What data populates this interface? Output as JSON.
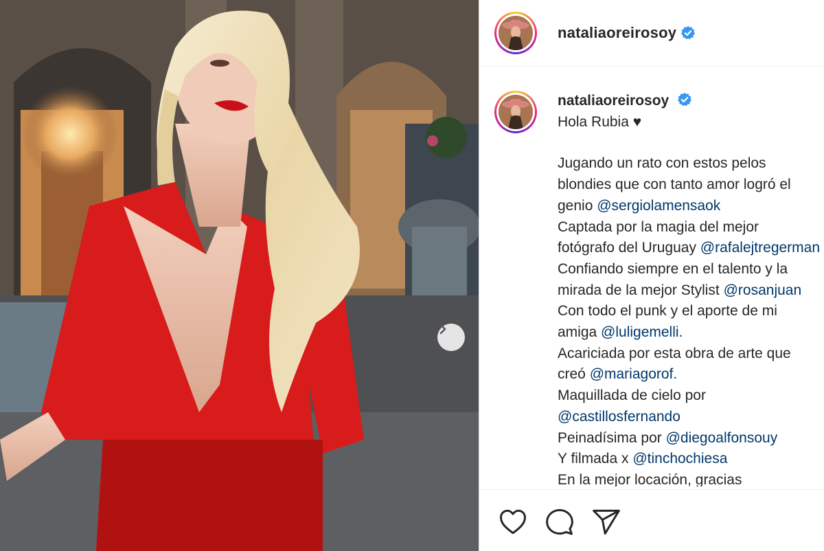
{
  "post": {
    "username": "nataliaoreirosoy",
    "verified_icon": "verified-badge-icon",
    "greeting": "Hola Rubia ♥",
    "lines": [
      {
        "text": "Jugando un rato con estos pelos",
        "mention": ""
      },
      {
        "text": "blondies que con tanto amor logró el",
        "mention": ""
      },
      {
        "text": "genio ",
        "mention": "@sergiolamensaok"
      },
      {
        "text": "Captada por la magia del mejor",
        "mention": ""
      },
      {
        "text": "fotógrafo del Uruguay ",
        "mention": "@rafalejtregerman"
      },
      {
        "text": "Confiando siempre en el talento y la",
        "mention": ""
      },
      {
        "text": "mirada de la mejor Stylist ",
        "mention": "@rosanjuan"
      },
      {
        "text": "Con todo el punk y el aporte de mi",
        "mention": ""
      },
      {
        "text": "amiga ",
        "mention": "@luligemelli."
      },
      {
        "text": "Acariciada por esta obra de arte que",
        "mention": ""
      },
      {
        "text": "creó ",
        "mention": "@mariagorof."
      },
      {
        "text": "Maquillada de cielo por",
        "mention": ""
      },
      {
        "text": "",
        "mention": "@castillosfernando"
      },
      {
        "text": "Peinadísima por ",
        "mention": "@diegoalfonsouy"
      },
      {
        "text": "Y filmada x ",
        "mention": "@tinchochiesa"
      },
      {
        "text": "En la mejor locación, gracias",
        "mention": ""
      }
    ]
  },
  "icons": {
    "like": "heart-icon",
    "comment": "comment-icon",
    "share": "share-icon",
    "next": "chevron-right-icon"
  },
  "colors": {
    "text": "#262626",
    "mention": "#00376b",
    "verified": "#3897f0",
    "dress": "#d81b1b"
  }
}
